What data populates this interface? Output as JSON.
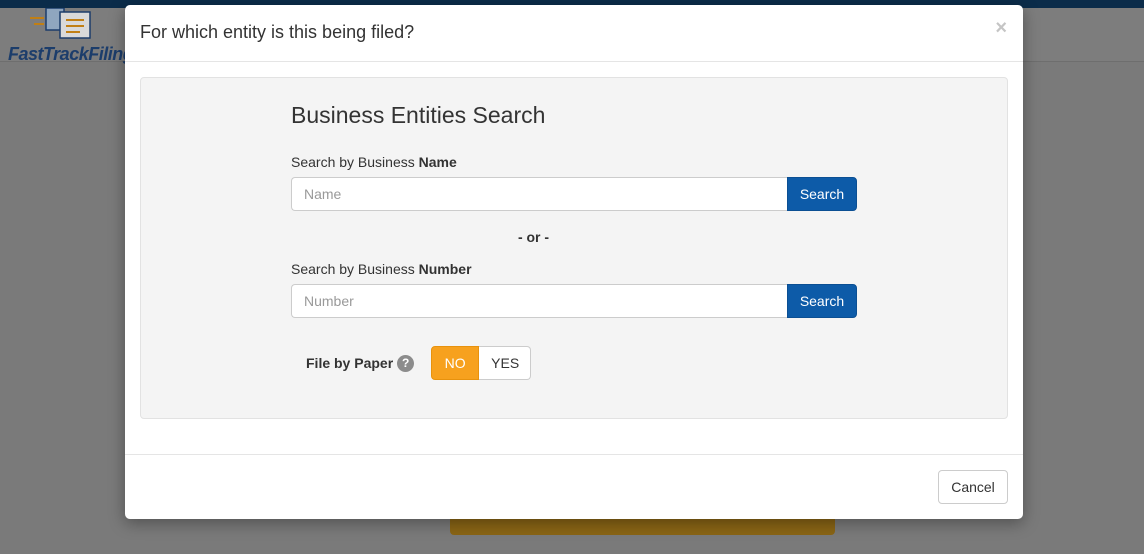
{
  "background": {
    "logo_text": "FastTrackFiling"
  },
  "modal": {
    "title": "For which entity is this being filed?",
    "close_symbol": "×",
    "section_title": "Business Entities Search",
    "name_search": {
      "label_prefix": "Search by Business ",
      "label_bold": "Name",
      "placeholder": "Name",
      "button_label": "Search"
    },
    "or_separator": "- or -",
    "number_search": {
      "label_prefix": "Search by Business ",
      "label_bold": "Number",
      "placeholder": "Number",
      "button_label": "Search"
    },
    "file_by_paper": {
      "label": "File by Paper",
      "help_icon": "question-circle-icon",
      "options": [
        "NO",
        "YES"
      ],
      "selected": "NO"
    },
    "cancel_label": "Cancel"
  },
  "colors": {
    "primary_button": "#0d5ba8",
    "toggle_active": "#f7a11e",
    "top_bar": "#0b2c4a"
  }
}
